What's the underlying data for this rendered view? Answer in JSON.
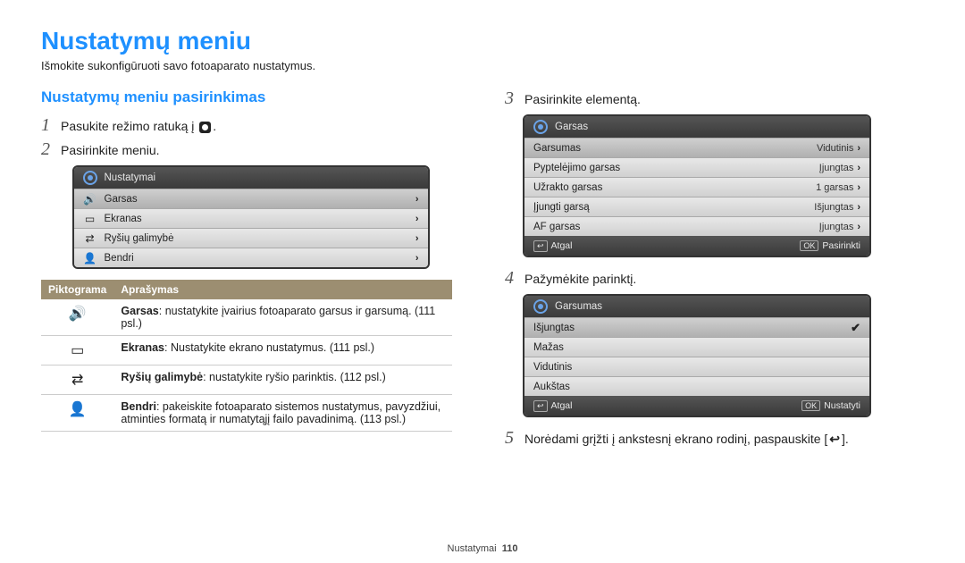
{
  "title": "Nustatymų meniu",
  "subtitle": "Išmokite sukonfigūruoti savo fotoaparato nustatymus.",
  "section_title": "Nustatymų meniu pasirinkimas",
  "steps": {
    "s1": "Pasukite režimo ratuką į ",
    "s1_suffix": ".",
    "s2": "Pasirinkite meniu.",
    "s3": "Pasirinkite elementą.",
    "s4": "Pažymėkite parinktį.",
    "s5a": "Norėdami grįžti į ankstesnį ekrano rodinį, paspauskite [",
    "s5b": "]."
  },
  "panel1": {
    "header": "Nustatymai",
    "rows": [
      {
        "icon": "🔊",
        "label": "Garsas",
        "sel": true
      },
      {
        "icon": "▭",
        "label": "Ekranas"
      },
      {
        "icon": "⇄",
        "label": "Ryšių galimybė"
      },
      {
        "icon": "👤",
        "label": "Bendri"
      }
    ]
  },
  "panel2": {
    "header": "Garsas",
    "rows": [
      {
        "label": "Garsumas",
        "val": "Vidutinis",
        "sel": true
      },
      {
        "label": "Pyptelėjimo garsas",
        "val": "Įjungtas"
      },
      {
        "label": "Užrakto garsas",
        "val": "1 garsas"
      },
      {
        "label": "Įjungti garsą",
        "val": "Išjungtas"
      },
      {
        "label": "AF garsas",
        "val": "Įjungtas"
      }
    ],
    "footer": {
      "back": "Atgal",
      "ok": "Pasirinkti"
    }
  },
  "panel3": {
    "header": "Garsumas",
    "rows": [
      {
        "label": "Išjungtas",
        "check": true,
        "sel": true
      },
      {
        "label": "Mažas"
      },
      {
        "label": "Vidutinis"
      },
      {
        "label": "Aukštas"
      }
    ],
    "footer": {
      "back": "Atgal",
      "ok": "Nustatyti"
    }
  },
  "table": {
    "h1": "Piktograma",
    "h2": "Aprašymas",
    "rows": [
      {
        "icon": "🔊",
        "bold": "Garsas",
        "text": ": nustatykite įvairius fotoaparato garsus ir garsumą. (111 psl.)"
      },
      {
        "icon": "▭",
        "bold": "Ekranas",
        "text": ": Nustatykite ekrano nustatymus. (111 psl.)"
      },
      {
        "icon": "⇄",
        "bold": "Ryšių galimybė",
        "text": ": nustatykite ryšio parinktis. (112 psl.)"
      },
      {
        "icon": "👤",
        "bold": "Bendri",
        "text": ": pakeiskite fotoaparato sistemos nustatymus, pavyzdžiui, atminties formatą ir numatytąjį failo pavadinimą. (113 psl.)"
      }
    ]
  },
  "footer_label": "Nustatymai",
  "footer_page": "110",
  "ok_key": "OK",
  "back_sym": "↩"
}
